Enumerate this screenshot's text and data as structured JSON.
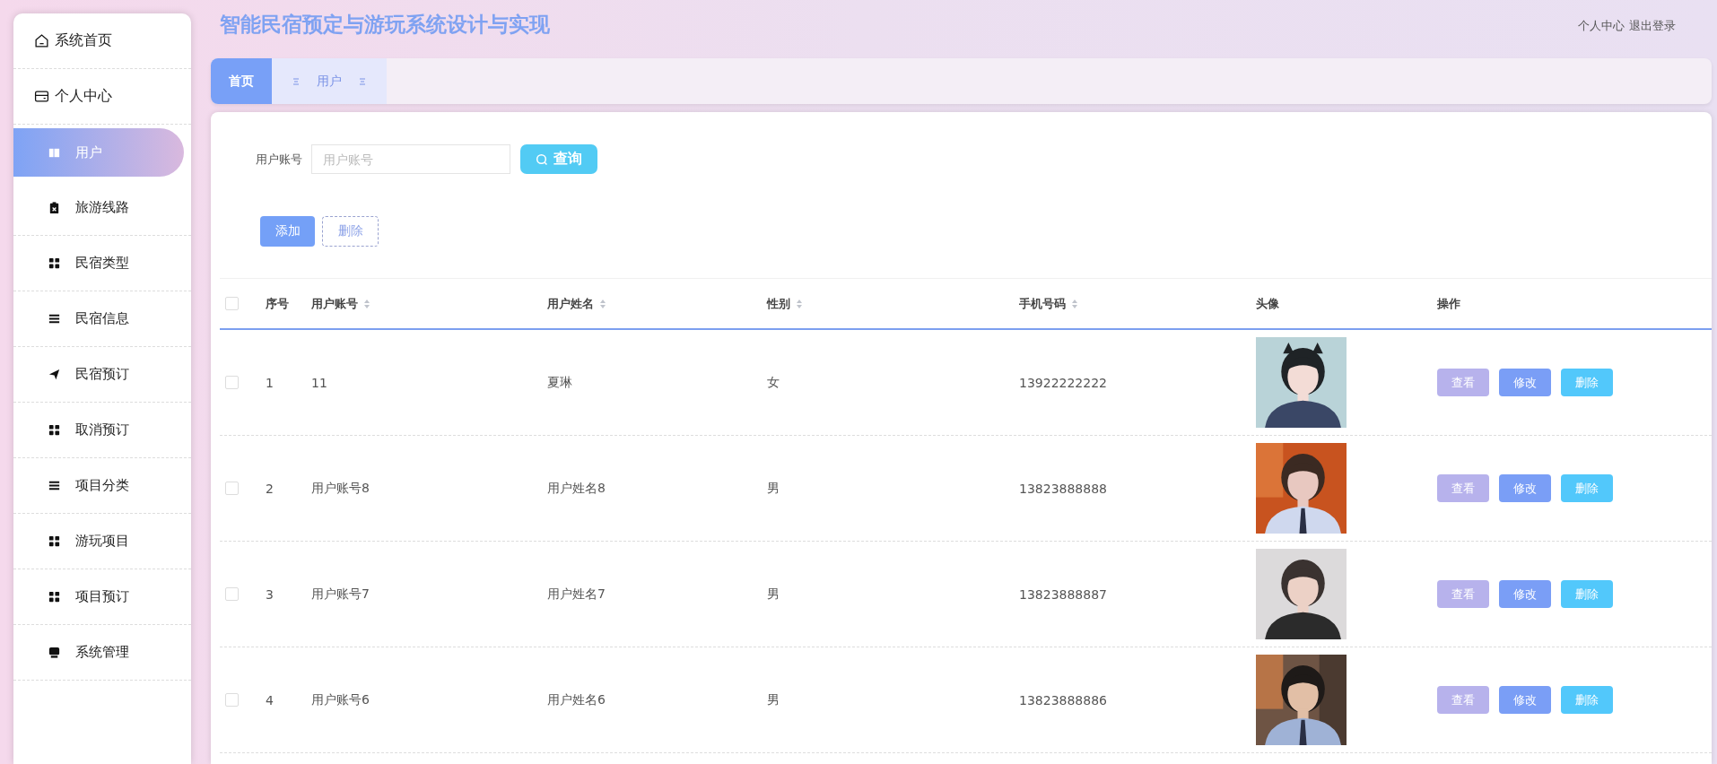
{
  "title": "智能民宿预定与游玩系统设计与实现",
  "header_links": [
    "个人中心",
    "退出登录"
  ],
  "sidebar": {
    "items": [
      {
        "label": "系统首页",
        "selected": false
      },
      {
        "label": "个人中心",
        "selected": false
      },
      {
        "label": "用户",
        "selected": true
      },
      {
        "label": "旅游线路",
        "selected": false
      },
      {
        "label": "民宿类型",
        "selected": false
      },
      {
        "label": "民宿信息",
        "selected": false
      },
      {
        "label": "民宿预订",
        "selected": false
      },
      {
        "label": "取消预订",
        "selected": false
      },
      {
        "label": "项目分类",
        "selected": false
      },
      {
        "label": "游玩项目",
        "selected": false
      },
      {
        "label": "项目预订",
        "selected": false
      },
      {
        "label": "系统管理",
        "selected": false
      }
    ]
  },
  "tabs": [
    {
      "label": "首页",
      "selected": true
    },
    {
      "label": "用户",
      "selected": false
    }
  ],
  "search": {
    "label": "用户账号",
    "placeholder": "用户账号",
    "button": "查询"
  },
  "actions": [
    "添加",
    "删除"
  ],
  "table": {
    "select_all_checked": false,
    "columns": [
      {
        "label": "序号",
        "sortable": false
      },
      {
        "label": "用户账号",
        "sortable": true
      },
      {
        "label": "用户姓名",
        "sortable": true
      },
      {
        "label": "性别",
        "sortable": true
      },
      {
        "label": "手机号码",
        "sortable": true
      },
      {
        "label": "头像",
        "sortable": false
      },
      {
        "label": "操作",
        "sortable": false
      }
    ],
    "rows": [
      {
        "checked": false,
        "index": "1",
        "account": "11",
        "name": "夏琳",
        "gender": "女",
        "phone": "13922222222",
        "avatar": {
          "kind": "picture"
        },
        "buttons": [
          "查看",
          "修改",
          "删除"
        ]
      },
      {
        "checked": false,
        "index": "2",
        "account": "用户账号8",
        "name": "用户姓名8",
        "gender": "男",
        "phone": "13823888888",
        "avatar": {
          "kind": "picture"
        },
        "buttons": [
          "查看",
          "修改",
          "删除"
        ]
      },
      {
        "checked": false,
        "index": "3",
        "account": "用户账号7",
        "name": "用户姓名7",
        "gender": "男",
        "phone": "13823888887",
        "avatar": {
          "kind": "picture"
        },
        "buttons": [
          "查看",
          "修改",
          "删除"
        ]
      },
      {
        "checked": false,
        "index": "4",
        "account": "用户账号6",
        "name": "用户姓名6",
        "gender": "男",
        "phone": "13823888886",
        "avatar": {
          "kind": "picture"
        },
        "buttons": [
          "查看",
          "修改",
          "删除"
        ]
      }
    ]
  }
}
